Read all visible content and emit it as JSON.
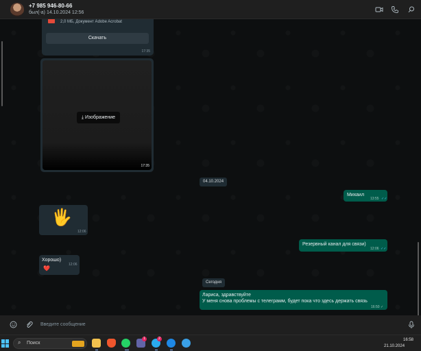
{
  "header": {
    "contact_name": "+7 985 946-80-66",
    "status": "был(-а) 14.10.2024 12:56",
    "icons": [
      "video-call-icon",
      "phone-icon",
      "search-icon"
    ]
  },
  "messages": {
    "document": {
      "meta": "2,0 МБ, Документ Adobe Acrobat",
      "download_label": "Скачать",
      "time": "17:35"
    },
    "image": {
      "button_label": "Изображение",
      "time": "17:35"
    },
    "date_1": "04.10.2024",
    "out_1": {
      "text": "Михаил",
      "time": "13:55"
    },
    "wave": {
      "emoji": "🖐",
      "time": "12:06"
    },
    "out_2": {
      "text": "Резервный канал для связи)",
      "time": "12:06"
    },
    "in_1": {
      "text": "Хорошо)",
      "emoji": "❤️",
      "time": "12:06"
    },
    "date_2": "Сегодня",
    "out_3": {
      "line1": "Лариса, здравствуйте",
      "line2": "У меня снова проблемы с телеграмм, будет пока что здесь держать связь",
      "time": "16:50"
    }
  },
  "composer": {
    "placeholder": "Введите сообщение"
  },
  "taskbar": {
    "search_label": "Поиск",
    "time": "16:58",
    "date": "21.10.2024",
    "badges": {
      "teams": "1",
      "telegram": "2"
    }
  },
  "colors": {
    "outgoing_bubble": "#005c4b",
    "incoming_bubble": "#202c33",
    "chat_bg": "#0d0f10",
    "read_tick": "#53bdeb"
  }
}
